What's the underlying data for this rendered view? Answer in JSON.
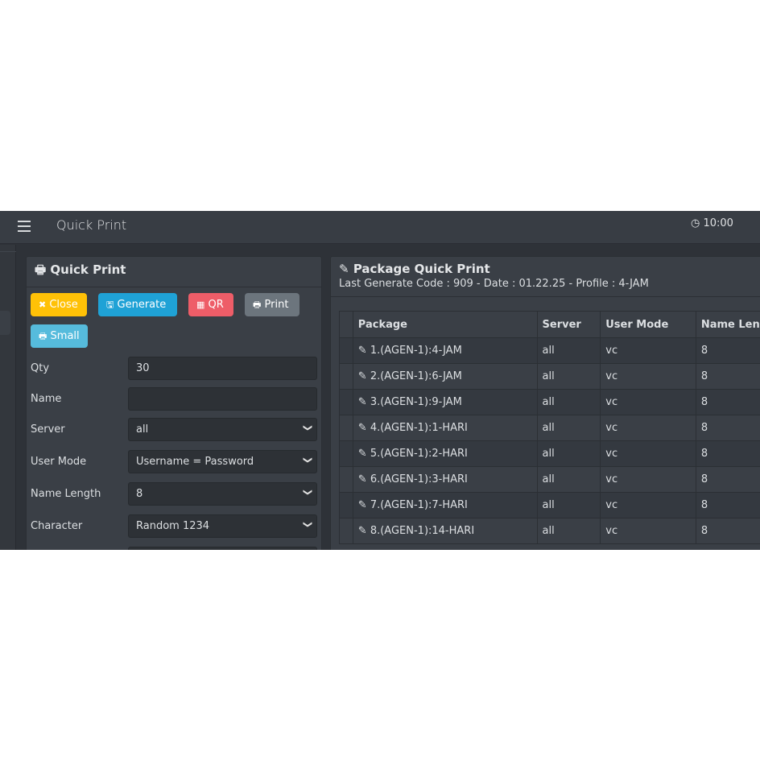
{
  "header": {
    "title": "Quick Print",
    "clock_icon": "clock-icon",
    "time": "10:00"
  },
  "left_card": {
    "title": "Quick Print",
    "buttons": [
      {
        "label": "Close",
        "color": "#ffc107"
      },
      {
        "label": "Generate",
        "color": "#1fa2d6"
      },
      {
        "label": "QR",
        "color": "#ee5d68"
      },
      {
        "label": "Print",
        "color": "#6c757d"
      },
      {
        "label": "Small",
        "color": "#56bbdc"
      }
    ],
    "fields": [
      {
        "label": "Qty",
        "value": "30"
      },
      {
        "label": "Name",
        "value": ""
      },
      {
        "label": "Server",
        "value": "all"
      },
      {
        "label": "User Mode",
        "value": "Username = Password"
      },
      {
        "label": "Name Length",
        "value": "8"
      },
      {
        "label": "Character",
        "value": "Random 1234"
      }
    ]
  },
  "right_card": {
    "title": "Package Quick Print",
    "subtitle": "Last Generate Code  : 909 - Date  : 01.22.25 - Profile  :  4-JAM",
    "columns": [
      "",
      "Package",
      "Server",
      "User Mode",
      "Name Length"
    ],
    "rows": [
      [
        "1.(AGEN-1):4-JAM",
        "all",
        "vc",
        "8"
      ],
      [
        "2.(AGEN-1):6-JAM",
        "all",
        "vc",
        "8"
      ],
      [
        "3.(AGEN-1):9-JAM",
        "all",
        "vc",
        "8"
      ],
      [
        "4.(AGEN-1):1-HARI",
        "all",
        "vc",
        "8"
      ],
      [
        "5.(AGEN-1):2-HARI",
        "all",
        "vc",
        "8"
      ],
      [
        "6.(AGEN-1):3-HARI",
        "all",
        "vc",
        "8"
      ],
      [
        "7.(AGEN-1):7-HARI",
        "all",
        "vc",
        "8"
      ],
      [
        "8.(AGEN-1):14-HARI",
        "all",
        "vc",
        "8"
      ]
    ]
  }
}
